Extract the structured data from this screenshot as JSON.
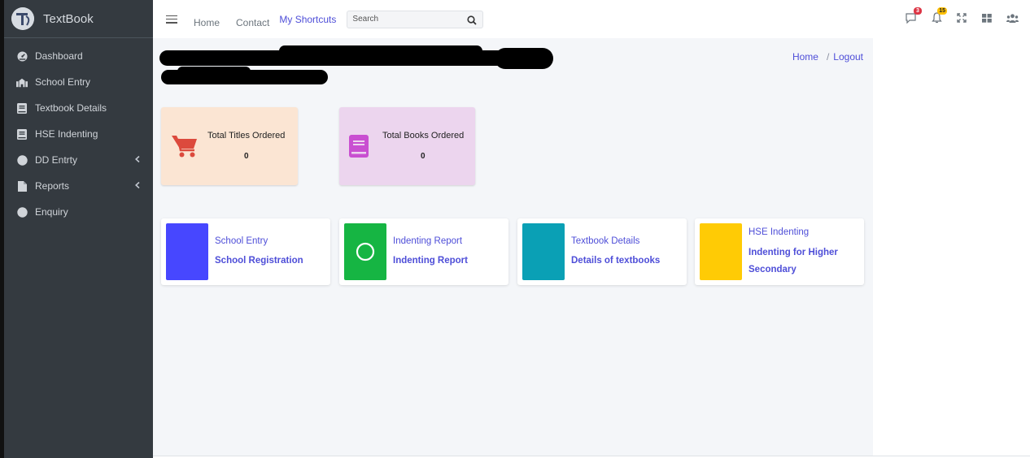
{
  "app": {
    "brand": "TextBook"
  },
  "sidebar": {
    "items": [
      {
        "label": "Dashboard",
        "icon": "tachometer-icon"
      },
      {
        "label": "School Entry",
        "icon": "school-icon"
      },
      {
        "label": "Textbook Details",
        "icon": "book-icon"
      },
      {
        "label": "HSE Indenting",
        "icon": "book-icon"
      },
      {
        "label": "DD Entrty",
        "icon": "circle-icon",
        "has_children": true
      },
      {
        "label": "Reports",
        "icon": "file-icon",
        "has_children": true
      },
      {
        "label": "Enquiry",
        "icon": "circle-icon"
      }
    ]
  },
  "topbar": {
    "links": [
      "Home",
      "Contact"
    ],
    "shortcuts_label": "My Shortcuts",
    "search_placeholder": "Search",
    "messages_badge": "3",
    "notifications_badge": "15"
  },
  "breadcrumb": {
    "home": "Home",
    "separator": "/",
    "logout": "Logout"
  },
  "stats": [
    {
      "label": "Total Titles Ordered",
      "value": "0",
      "color": "#fbe5d3",
      "icon": "shopping-cart-icon",
      "icon_color": "#dc4a3d"
    },
    {
      "label": "Total Books Ordered",
      "value": "0",
      "color": "#ecd5ee",
      "icon": "book-icon",
      "icon_color": "#c94fd1"
    }
  ],
  "shortcuts": [
    {
      "title": "School Entry",
      "subtitle": "School Registration",
      "color": "#4747ff"
    },
    {
      "title": "Indenting Report",
      "subtitle": "Indenting Report",
      "color": "#16b543",
      "icon": "circle-outline-icon"
    },
    {
      "title": "Textbook Details",
      "subtitle": "Details of textbooks",
      "color": "#0aa0b5"
    },
    {
      "title": "HSE Indenting",
      "subtitle": "Indenting for Higher Secondary",
      "color": "#ffcb05"
    }
  ],
  "colors": {
    "sidebar": "#343a40",
    "accent": "#4e4ed8",
    "content_bg": "#f4f6f9"
  }
}
